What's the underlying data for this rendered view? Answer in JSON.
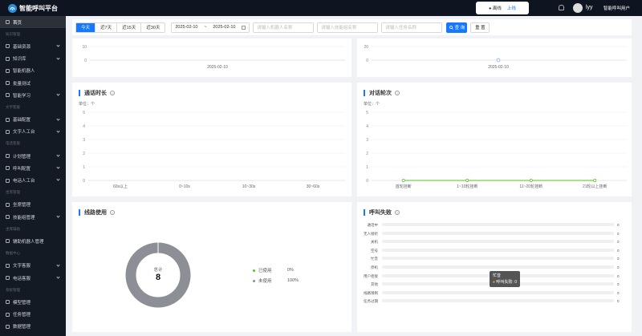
{
  "topbar": {
    "app_title": "智能呼叫平台",
    "offline_label": "离线",
    "online_label": "上线",
    "username": "lyy",
    "tenant": "智能呼叫用户"
  },
  "sidebar": {
    "items": [
      {
        "type": "item",
        "label": "首页",
        "active": true
      },
      {
        "type": "group",
        "label": "知识管理"
      },
      {
        "type": "item",
        "label": "基础资源",
        "chevron": true
      },
      {
        "type": "item",
        "label": "知识库",
        "chevron": true
      },
      {
        "type": "item",
        "label": "智能机器人"
      },
      {
        "type": "item",
        "label": "批量测试"
      },
      {
        "type": "item",
        "label": "智能学习",
        "chevron": true
      },
      {
        "type": "group",
        "label": "文字客服"
      },
      {
        "type": "item",
        "label": "基础配置",
        "chevron": true
      },
      {
        "type": "item",
        "label": "文字人工台",
        "chevron": true
      },
      {
        "type": "group",
        "label": "电话客服"
      },
      {
        "type": "item",
        "label": "计划管理",
        "chevron": true
      },
      {
        "type": "item",
        "label": "呼叫配置",
        "chevron": true
      },
      {
        "type": "item",
        "label": "电话人工台",
        "chevron": true
      },
      {
        "type": "group",
        "label": "坐席管理"
      },
      {
        "type": "item",
        "label": "坐席管理"
      },
      {
        "type": "item",
        "label": "技能组管理",
        "chevron": true
      },
      {
        "type": "group",
        "label": "坐席辅助"
      },
      {
        "type": "item",
        "label": "辅助机器人管理"
      },
      {
        "type": "group",
        "label": "数据中心"
      },
      {
        "type": "item",
        "label": "文字客服",
        "chevron": true
      },
      {
        "type": "item",
        "label": "电话客服",
        "chevron": true
      },
      {
        "type": "group",
        "label": "系统管理"
      },
      {
        "type": "item",
        "label": "模型管理"
      },
      {
        "type": "item",
        "label": "任务管理"
      },
      {
        "type": "item",
        "label": "数据管理"
      }
    ]
  },
  "filters": {
    "ranges": [
      "今天",
      "近7天",
      "近15天",
      "近30天"
    ],
    "date_start": "2025-02-10",
    "date_sep": "~",
    "date_end": "2025-02-10",
    "robot_placeholder": "请输入机器人名称",
    "skill_placeholder": "请输入技能组名称",
    "task_placeholder": "请输入任务名称",
    "search_label": "查 询",
    "reset_label": "重 置"
  },
  "top_left_chart": {
    "ticks": [
      "10",
      "0"
    ],
    "x_label": "2025-02-10"
  },
  "top_right_chart": {
    "ticks": [
      "20",
      "0"
    ],
    "x_label": "2025-02-10"
  },
  "colors": {
    "accent": "#1677ff",
    "line_green": "#52c41a",
    "ring_gray": "#8c8f96",
    "sidebar_bg": "#141a24"
  },
  "chart_data": [
    {
      "type": "bar",
      "title": "通话时长",
      "unit_label": "单位：个",
      "categories": [
        "60s以上",
        "0~10s",
        "10~30s",
        "30~60s"
      ],
      "values": [
        0,
        0,
        0,
        0
      ],
      "ylim": [
        0,
        5
      ],
      "yticks": [
        "0",
        "1",
        "2",
        "3",
        "4",
        "5"
      ]
    },
    {
      "type": "line",
      "title": "对话轮次",
      "unit_label": "单位：个",
      "categories": [
        "首轮挂断",
        "1~10轮挂断",
        "11~20轮挂断",
        "21轮以上挂断"
      ],
      "values": [
        0,
        0,
        0,
        0
      ],
      "ylim": [
        0,
        5
      ],
      "yticks": [
        "0",
        "1",
        "2",
        "3",
        "4",
        "5"
      ]
    },
    {
      "type": "pie",
      "title": "线路使用",
      "total_label": "总计",
      "total": 8,
      "slices": [
        {
          "name": "已使用",
          "percent": "0%",
          "value": 0
        },
        {
          "name": "未使用",
          "percent": "100%",
          "value": 8
        }
      ]
    },
    {
      "type": "bar",
      "title": "呼叫失败",
      "categories": [
        "通话中",
        "无人接听",
        "关机",
        "空号",
        "忙音",
        "停机",
        "用户拒接",
        "其他",
        "线路限制",
        "任务过期"
      ],
      "values": [
        0,
        0,
        0,
        0,
        0,
        0,
        0,
        0,
        0,
        0
      ],
      "tooltip": {
        "title": "忙音",
        "label": "呼叫失败: 0"
      }
    }
  ]
}
